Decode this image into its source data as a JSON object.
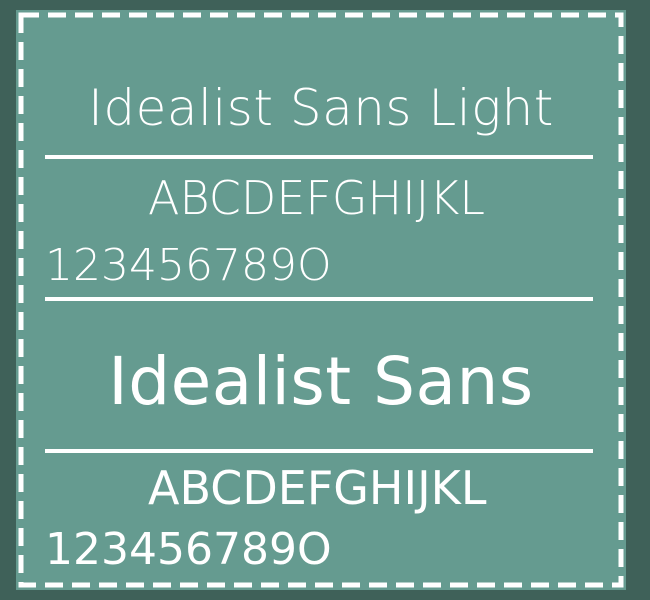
{
  "specimens": [
    {
      "title": "Idealist Sans Light",
      "letters": "ABCDEFGHIJKL",
      "digits": "123456789O"
    },
    {
      "title": "Idealist Sans",
      "letters": "ABCDEFGHIJKL",
      "digits": "123456789O"
    }
  ],
  "colors": {
    "outer_background": "#3f6159",
    "card_background": "#659b90",
    "text": "#ffffff",
    "divider": "#ffffff",
    "dashed_border": "#ffffff"
  }
}
